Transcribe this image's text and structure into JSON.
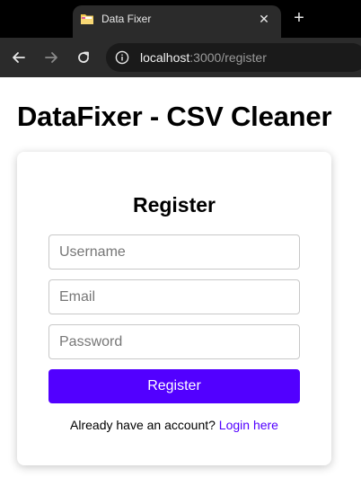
{
  "browser": {
    "tab_title": "Data Fixer",
    "close_glyph": "✕",
    "new_tab_glyph": "+",
    "url_host": "localhost",
    "url_path": ":3000/register",
    "icons": {
      "favicon": "folder-icon",
      "close": "close-icon",
      "new_tab": "plus-icon",
      "back": "arrow-left-icon",
      "forward": "arrow-right-icon",
      "reload": "reload-icon",
      "site_info": "info-icon"
    }
  },
  "page": {
    "title": "DataFixer - CSV Cleaner"
  },
  "register_form": {
    "heading": "Register",
    "username_placeholder": "Username",
    "username_value": "",
    "email_placeholder": "Email",
    "email_value": "",
    "password_placeholder": "Password",
    "password_value": "",
    "submit_label": "Register",
    "login_prompt": "Already have an account?",
    "login_link": "Login here"
  },
  "colors": {
    "accent": "#5200ff",
    "chrome_dark": "#000000",
    "chrome_toolbar": "#2b2b2b"
  }
}
